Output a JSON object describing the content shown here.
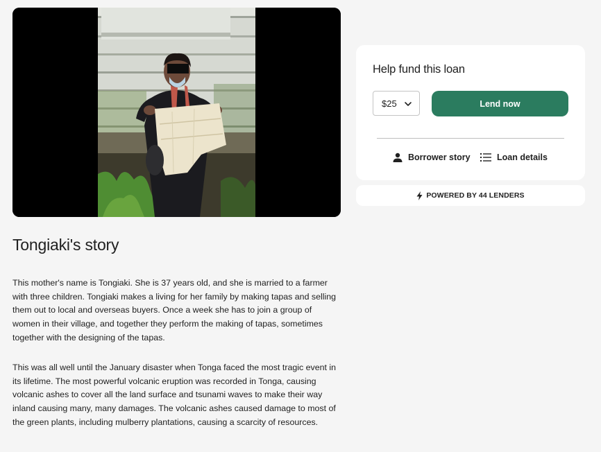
{
  "photo": {
    "alt": "Borrower holding a tapa cloth"
  },
  "story": {
    "title": "Tongiaki's story",
    "paragraphs": [
      "This mother's name is Tongiaki. She is 37 years old, and she is married to a farmer with three children. Tongiaki makes a living for her family by making tapas and selling them out to local and overseas buyers. Once a week she has to join a group of women in their village, and together they perform the making of tapas, sometimes together with the designing of the tapas.",
      "This was all well until the January disaster when Tonga faced the most tragic event in its lifetime. The most powerful volcanic eruption was recorded in Tonga, causing volcanic ashes to cover all the land surface and tsunami waves to make their way inland causing many, many damages. The volcanic ashes caused damage to most of the green plants, including mulberry plantations, causing a scarcity of resources."
    ]
  },
  "fund_card": {
    "title": "Help fund this loan",
    "amount_selected": "$25",
    "lend_button": "Lend now",
    "links": {
      "borrower_story": "Borrower story",
      "loan_details": "Loan details"
    }
  },
  "powered": {
    "label": "POWERED BY 44 LENDERS"
  },
  "colors": {
    "page_background": "#f5f5f5",
    "card_background": "#ffffff",
    "primary_green": "#2b7c5f",
    "text": "#212121"
  },
  "icons": {
    "amount_dropdown": "chevron-down-icon",
    "borrower_story": "person-icon",
    "loan_details": "list-icon",
    "powered": "lightning-bolt-icon"
  }
}
